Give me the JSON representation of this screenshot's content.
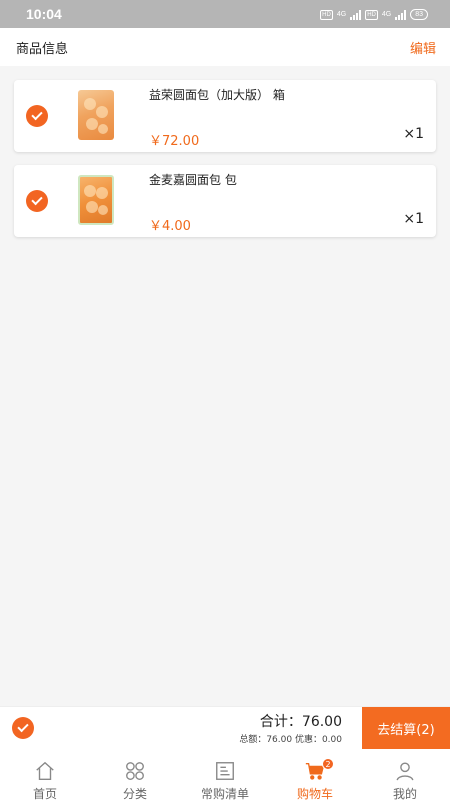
{
  "status_bar": {
    "time": "10:04",
    "sim1": "HD",
    "net1": "4G",
    "sim2": "HD",
    "net2": "4G",
    "battery": "83"
  },
  "header": {
    "title": "商品信息",
    "edit_label": "编辑"
  },
  "cart_items": [
    {
      "name": "益荣圆面包（加大版） 箱",
      "price": "￥72.00",
      "qty": "×1",
      "checked": true
    },
    {
      "name": "金麦嘉圆面包 包",
      "price": "￥4.00",
      "qty": "×1",
      "checked": true
    }
  ],
  "footer": {
    "total_label": "合计：",
    "total_value": "76.00",
    "subtotal_text": "总额：76.00  优惠：0.00",
    "checkout_label": "去结算(2)"
  },
  "tabbar": {
    "tabs": [
      {
        "label": "首页",
        "icon": "home-icon"
      },
      {
        "label": "分类",
        "icon": "category-icon"
      },
      {
        "label": "常购清单",
        "icon": "list-icon"
      },
      {
        "label": "购物车",
        "icon": "cart-icon",
        "badge": "2",
        "active": true
      },
      {
        "label": "我的",
        "icon": "user-icon"
      }
    ]
  },
  "colors": {
    "accent": "#f06a1c",
    "checkout_bg": "#f36b21",
    "statusbar_bg": "#b5b5b5"
  }
}
